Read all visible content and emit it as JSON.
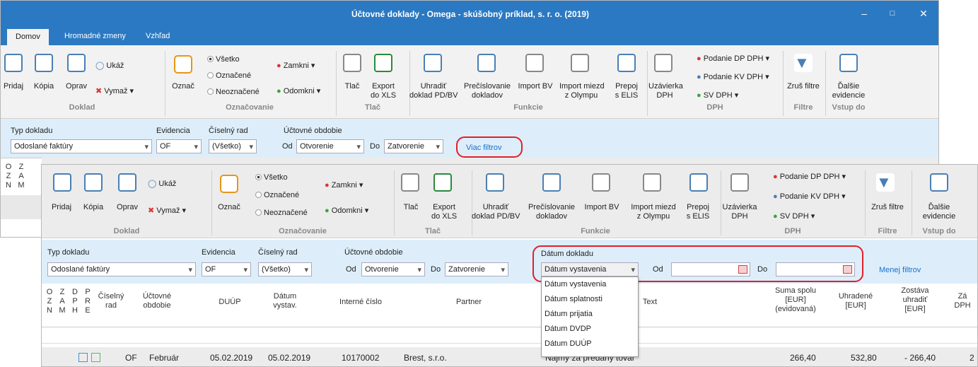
{
  "window": {
    "title": "Účtovné doklady - Omega - skúšobný príklad, s. r. o. (2019)"
  },
  "tabs": [
    "Domov",
    "Hromadné zmeny",
    "Vzhľad"
  ],
  "ribbon": {
    "pridaj": "Pridaj",
    "kopia": "Kópia",
    "oprav": "Oprav",
    "ukaz": "Ukáž",
    "vymaz": "Vymaž",
    "oznac": "Označ",
    "vsetko": "Všetko",
    "oznacene": "Označené",
    "neoznacene": "Neoznačené",
    "zamkni": "Zamkni",
    "odomkni": "Odomkni",
    "tlac": "Tlač",
    "export": "Export\ndo XLS",
    "uhradit": "Uhradiť\ndoklad PD/BV",
    "precislovanie": "Prečíslovanie\ndokladov",
    "import_bv": "Import BV",
    "import_miezd": "Import miezd\nz Olympu",
    "prepoj": "Prepoj\ns ELIS",
    "uzavierka": "Uzávierka\nDPH",
    "podanie_dp": "Podanie DP DPH",
    "podanie_kv": "Podanie KV DPH",
    "sv_dph": "SV DPH",
    "zrus_filtre": "Zruš filtre",
    "dalsie": "Ďalšie\nevidencie",
    "groups": {
      "doklad": "Doklad",
      "oznacovanie": "Označovanie",
      "tlac": "Tlač",
      "funkcie": "Funkcie",
      "dph": "DPH",
      "filtre": "Filtre",
      "vstup": "Vstup do"
    }
  },
  "filters": {
    "typ_label": "Typ dokladu",
    "typ_value": "Odoslané faktúry",
    "evidencia_label": "Evidencia",
    "evidencia_value": "OF",
    "rad_label": "Číselný rad",
    "rad_value": "(Všetko)",
    "obdobie_label": "Účtovné obdobie",
    "od": "Od",
    "od_value": "Otvorenie",
    "do": "Do",
    "do_value": "Zatvorenie",
    "viac": "Viac filtrov",
    "menej": "Menej filtrov",
    "datum_label": "Dátum dokladu",
    "datum_value": "Dátum vystavenia"
  },
  "dropdown_options": [
    "Dátum vystavenia",
    "Dátum splatnosti",
    "Dátum prijatia",
    "Dátum DVDP",
    "Dátum DUÚP"
  ],
  "back_cols": {
    "ozn": "O\nZ\nN",
    "zam": "Z\nA\nM"
  },
  "columns": {
    "ozn": "O\nZ\nN",
    "zam": "Z\nA\nM",
    "dph": "D\nP\nH",
    "pre": "P\nR\nE",
    "rad": "Číselný\nrad",
    "obdobie": "Účtovné\nobdobie",
    "duup": "DUÚP",
    "datum": "Dátum\nvystav.",
    "interne": "Interné číslo",
    "partner": "Partner",
    "text": "Text",
    "suma": "Suma spolu\n[EUR]\n(evidovaná)",
    "uhradene": "Uhradené\n[EUR]",
    "zostava": "Zostáva\nuhradiť\n[EUR]",
    "za": "Zá\nDPH"
  },
  "row": {
    "rad": "OF",
    "obdobie": "Február",
    "duup": "05.02.2019",
    "datum": "05.02.2019",
    "interne": "10170002",
    "partner": "Brest, s.r.o.",
    "text": "Nájmy za predaný tovar",
    "suma": "266,40",
    "uhradene": "532,80",
    "zostava": "-  266,40",
    "za": "2"
  }
}
